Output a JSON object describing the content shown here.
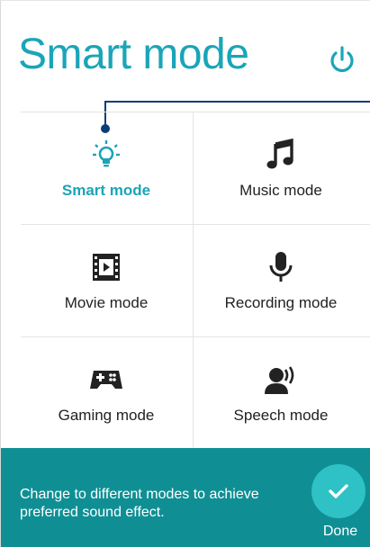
{
  "header": {
    "title": "Smart mode",
    "power_icon": "power-icon"
  },
  "colors": {
    "accent": "#1aa5b8",
    "callout": "#0c3c78",
    "tip_bg": "#0f8f94",
    "done_bg": "#2ec1c6"
  },
  "modes": [
    {
      "label": "Smart mode",
      "icon": "lightbulb-icon",
      "active": true
    },
    {
      "label": "Music mode",
      "icon": "music-note-icon",
      "active": false
    },
    {
      "label": "Movie mode",
      "icon": "film-icon",
      "active": false
    },
    {
      "label": "Recording mode",
      "icon": "microphone-icon",
      "active": false
    },
    {
      "label": "Gaming mode",
      "icon": "gamepad-icon",
      "active": false
    },
    {
      "label": "Speech mode",
      "icon": "speech-icon",
      "active": false
    }
  ],
  "tip": {
    "text": "Change to different modes to achieve preferred sound effect.",
    "done_label": "Done",
    "done_icon": "checkmark-icon"
  }
}
